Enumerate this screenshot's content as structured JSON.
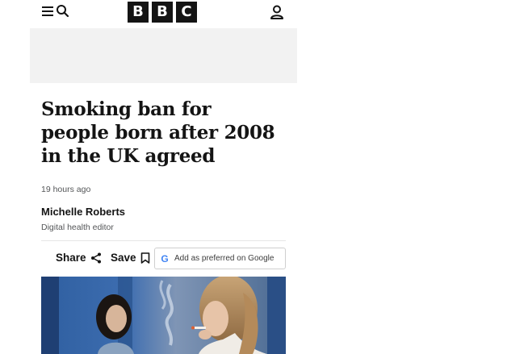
{
  "header": {
    "menu_icon": "menu-icon",
    "search_icon": "search-icon",
    "logo_letters": [
      "B",
      "B",
      "C"
    ],
    "account_icon": "account-icon"
  },
  "article": {
    "headline": "Smoking ban for people born after 2008 in the UK agreed",
    "timestamp": "19 hours ago",
    "author_name": "Michelle Roberts",
    "author_role": "Digital health editor"
  },
  "actions": {
    "share_label": "Share",
    "share_icon": "share-icon",
    "save_label": "Save",
    "save_icon": "bookmark-icon",
    "google_label": "Add as preferred on Google",
    "google_icon": "google-g-icon"
  },
  "colors": {
    "text": "#141414",
    "muted": "#545658",
    "ad_background": "#f2f2f2"
  }
}
